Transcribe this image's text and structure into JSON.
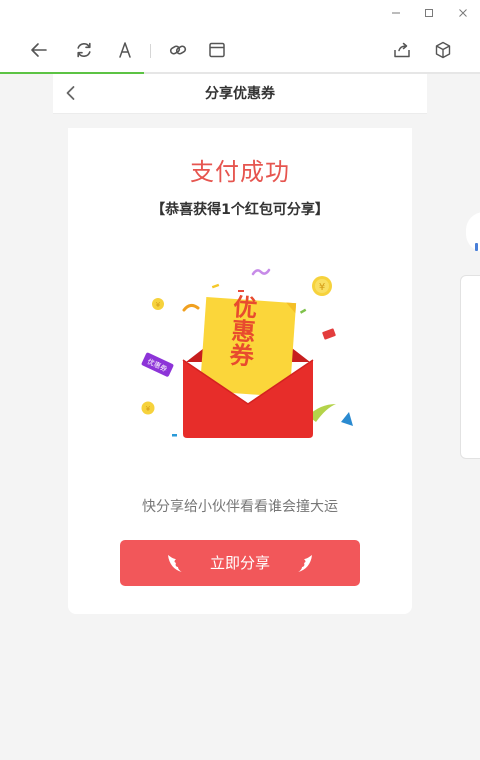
{
  "browser": {
    "progress_fraction": 0.3,
    "accent_color": "#5cc344"
  },
  "nav": {
    "title": "分享优惠券"
  },
  "card": {
    "title": "支付成功",
    "subtitle": "【恭喜获得1个红包可分享】",
    "envelope_card_text": "优惠券",
    "ticket_tag_text": "优惠券",
    "share_prompt": "快分享给小伙伴看看谁会撞大运",
    "share_button_label": "立即分享",
    "title_color": "#e6554f",
    "button_color": "#f2575a"
  }
}
